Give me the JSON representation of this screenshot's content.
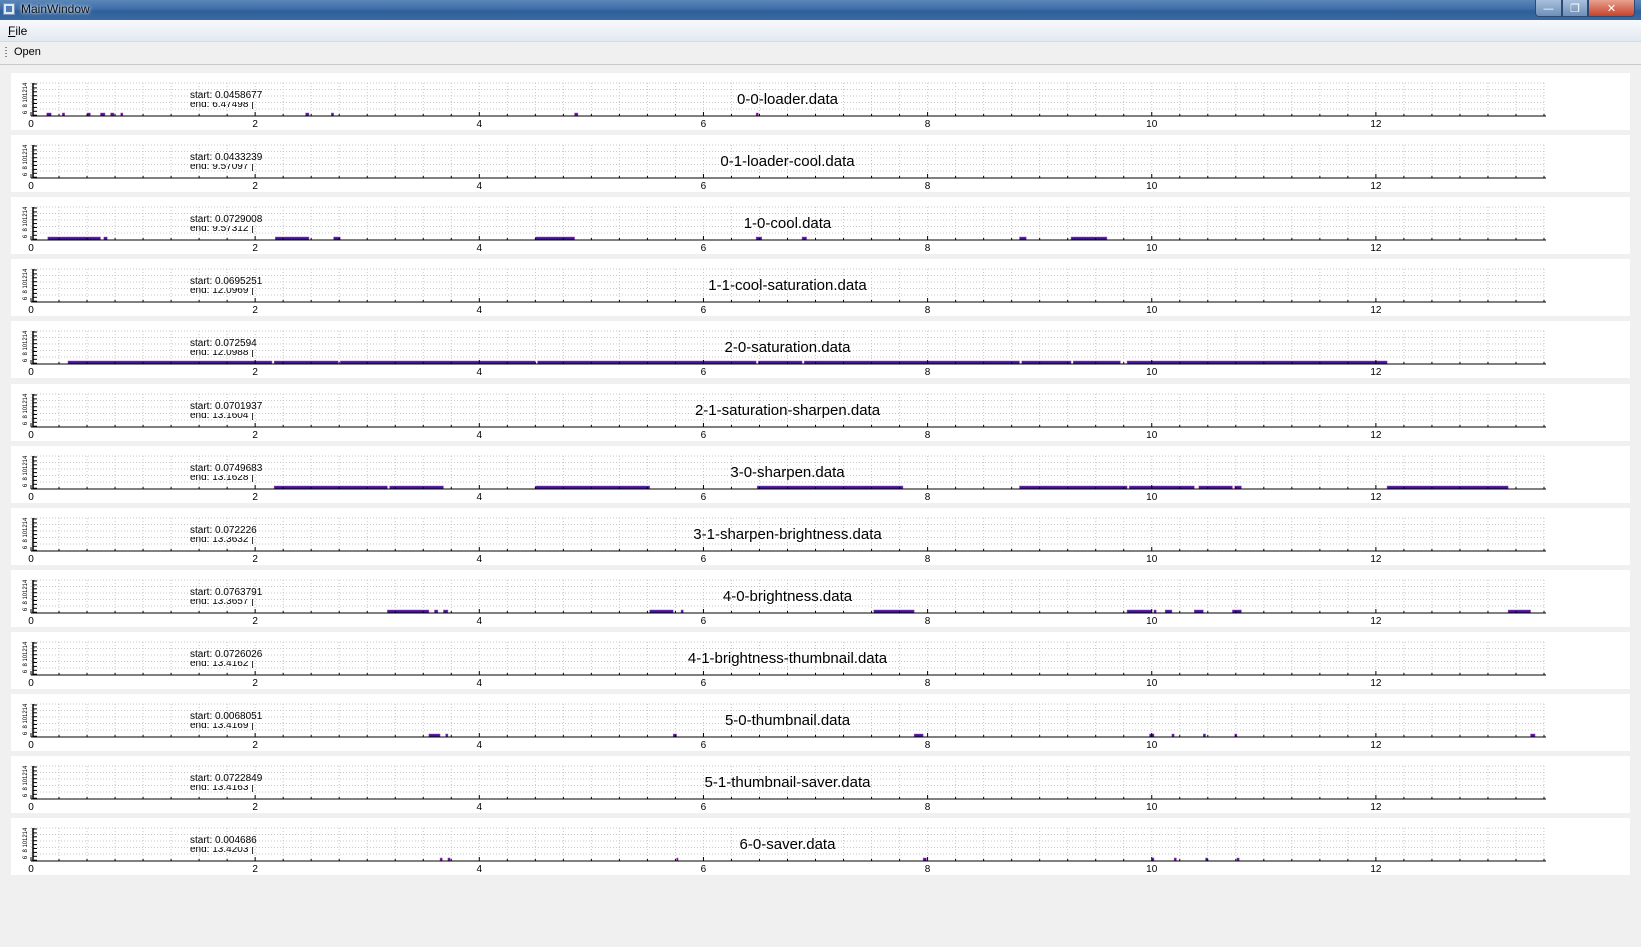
{
  "window": {
    "title": "MainWindow",
    "controls": {
      "minimize": "—",
      "maximize": "❐",
      "close": "✕"
    },
    "icon": "app-window-icon"
  },
  "menubar": {
    "items": [
      {
        "label": "File",
        "mnemonic": "F",
        "rest": "ile"
      }
    ]
  },
  "toolbar": {
    "items": [
      {
        "label": "Open"
      }
    ]
  },
  "plot_style": {
    "axis_color": "#000000",
    "grid_color": "#c8c8c8",
    "bar_color": "#3a1a9a",
    "bar_edge": "#c040c0"
  },
  "chart_data": [
    {
      "type": "bar",
      "title": "0-0-loader.data",
      "start_label": "start: 0.0458677",
      "end_label": "end: 6.47498 |",
      "xlim": [
        0,
        13.5
      ],
      "x_ticks": [
        "0",
        "2",
        "4",
        "6",
        "8",
        "10",
        "12"
      ],
      "y_ticks": [
        "14",
        "12",
        "10",
        "8",
        "6"
      ],
      "intervals": [
        [
          0.14,
          0.18
        ],
        [
          0.28,
          0.3
        ],
        [
          0.5,
          0.53
        ],
        [
          0.62,
          0.66
        ],
        [
          0.71,
          0.74
        ],
        [
          0.8,
          0.82
        ],
        [
          2.45,
          2.48
        ],
        [
          2.68,
          2.7
        ],
        [
          4.85,
          4.88
        ],
        [
          6.47,
          6.49
        ]
      ]
    },
    {
      "type": "bar",
      "title": "0-1-loader-cool.data",
      "start_label": "start: 0.0433239",
      "end_label": "end: 9.57097 |",
      "xlim": [
        0,
        13.5
      ],
      "x_ticks": [
        "0",
        "2",
        "4",
        "6",
        "8",
        "10",
        "12"
      ],
      "y_ticks": [
        "14",
        "12",
        "10",
        "8",
        "6"
      ],
      "intervals": []
    },
    {
      "type": "bar",
      "title": "1-0-cool.data",
      "start_label": "start: 0.0729008",
      "end_label": "end: 9.57312 |",
      "xlim": [
        0,
        13.5
      ],
      "x_ticks": [
        "0",
        "2",
        "4",
        "6",
        "8",
        "10",
        "12"
      ],
      "y_ticks": [
        "14",
        "12",
        "10",
        "8",
        "6"
      ],
      "intervals": [
        [
          0.15,
          0.62
        ],
        [
          0.65,
          0.68
        ],
        [
          2.18,
          2.48
        ],
        [
          2.7,
          2.76
        ],
        [
          4.5,
          4.85
        ],
        [
          6.47,
          6.52
        ],
        [
          6.88,
          6.92
        ],
        [
          8.82,
          8.88
        ],
        [
          9.28,
          9.6
        ]
      ]
    },
    {
      "type": "bar",
      "title": "1-1-cool-saturation.data",
      "start_label": "start: 0.0695251",
      "end_label": "end: 12.0969 |",
      "xlim": [
        0,
        13.5
      ],
      "x_ticks": [
        "0",
        "2",
        "4",
        "6",
        "8",
        "10",
        "12"
      ],
      "y_ticks": [
        "14",
        "12",
        "10",
        "8",
        "6"
      ],
      "intervals": []
    },
    {
      "type": "bar",
      "title": "2-0-saturation.data",
      "start_label": "start: 0.072594",
      "end_label": "end: 12.0988 |",
      "xlim": [
        0,
        13.5
      ],
      "x_ticks": [
        "0",
        "2",
        "4",
        "6",
        "8",
        "10",
        "12"
      ],
      "y_ticks": [
        "14",
        "12",
        "10",
        "8",
        "6"
      ],
      "intervals": [
        [
          0.33,
          2.15
        ],
        [
          2.17,
          2.74
        ],
        [
          2.76,
          4.5
        ],
        [
          4.52,
          6.47
        ],
        [
          6.49,
          6.88
        ],
        [
          6.9,
          8.82
        ],
        [
          8.84,
          9.28
        ],
        [
          9.3,
          9.72
        ],
        [
          9.78,
          12.1
        ]
      ]
    },
    {
      "type": "bar",
      "title": "2-1-saturation-sharpen.data",
      "start_label": "start: 0.0701937",
      "end_label": "end: 13.1604 |",
      "xlim": [
        0,
        13.5
      ],
      "x_ticks": [
        "0",
        "2",
        "4",
        "6",
        "8",
        "10",
        "12"
      ],
      "y_ticks": [
        "14",
        "12",
        "10",
        "8",
        "6"
      ],
      "intervals": []
    },
    {
      "type": "bar",
      "title": "3-0-sharpen.data",
      "start_label": "start: 0.0749683",
      "end_label": "end: 13.1628 |",
      "xlim": [
        0,
        13.5
      ],
      "x_ticks": [
        "0",
        "2",
        "4",
        "6",
        "8",
        "10",
        "12"
      ],
      "y_ticks": [
        "14",
        "12",
        "10",
        "8",
        "6"
      ],
      "intervals": [
        [
          2.17,
          3.18
        ],
        [
          3.2,
          3.68
        ],
        [
          4.5,
          5.52
        ],
        [
          6.48,
          7.78
        ],
        [
          8.82,
          9.78
        ],
        [
          9.8,
          10.38
        ],
        [
          10.42,
          10.72
        ],
        [
          10.74,
          10.8
        ],
        [
          12.1,
          13.18
        ]
      ]
    },
    {
      "type": "bar",
      "title": "3-1-sharpen-brightness.data",
      "start_label": "start: 0.072226",
      "end_label": "end: 13.3632 |",
      "xlim": [
        0,
        13.5
      ],
      "x_ticks": [
        "0",
        "2",
        "4",
        "6",
        "8",
        "10",
        "12"
      ],
      "y_ticks": [
        "14",
        "12",
        "10",
        "8",
        "6"
      ],
      "intervals": []
    },
    {
      "type": "bar",
      "title": "4-0-brightness.data",
      "start_label": "start: 0.0763791",
      "end_label": "end: 13.3657 |",
      "xlim": [
        0,
        13.5
      ],
      "x_ticks": [
        "0",
        "2",
        "4",
        "6",
        "8",
        "10",
        "12"
      ],
      "y_ticks": [
        "14",
        "12",
        "10",
        "8",
        "6"
      ],
      "intervals": [
        [
          3.18,
          3.55
        ],
        [
          3.6,
          3.63
        ],
        [
          3.68,
          3.72
        ],
        [
          5.52,
          5.73
        ],
        [
          5.8,
          5.82
        ],
        [
          7.52,
          7.88
        ],
        [
          9.78,
          10.0
        ],
        [
          10.02,
          10.04
        ],
        [
          10.12,
          10.18
        ],
        [
          10.38,
          10.46
        ],
        [
          10.72,
          10.8
        ],
        [
          13.18,
          13.38
        ]
      ]
    },
    {
      "type": "bar",
      "title": "4-1-brightness-thumbnail.data",
      "start_label": "start: 0.0726026",
      "end_label": "end: 13.4162 |",
      "xlim": [
        0,
        13.5
      ],
      "x_ticks": [
        "0",
        "2",
        "4",
        "6",
        "8",
        "10",
        "12"
      ],
      "y_ticks": [
        "14",
        "12",
        "10",
        "8",
        "6"
      ],
      "intervals": []
    },
    {
      "type": "bar",
      "title": "5-0-thumbnail.data",
      "start_label": "start: 0.0068051",
      "end_label": "end: 13.4169 |",
      "xlim": [
        0,
        13.5
      ],
      "x_ticks": [
        "0",
        "2",
        "4",
        "6",
        "8",
        "10",
        "12"
      ],
      "y_ticks": [
        "14",
        "12",
        "10",
        "8",
        "6"
      ],
      "intervals": [
        [
          3.55,
          3.65
        ],
        [
          3.7,
          3.72
        ],
        [
          5.73,
          5.76
        ],
        [
          7.88,
          7.96
        ],
        [
          9.98,
          10.02
        ],
        [
          10.18,
          10.2
        ],
        [
          10.46,
          10.48
        ],
        [
          10.74,
          10.76
        ],
        [
          13.38,
          13.42
        ]
      ]
    },
    {
      "type": "bar",
      "title": "5-1-thumbnail-saver.data",
      "start_label": "start: 0.0722849",
      "end_label": "end: 13.4163 |",
      "xlim": [
        0,
        13.5
      ],
      "x_ticks": [
        "0",
        "2",
        "4",
        "6",
        "8",
        "10",
        "12"
      ],
      "y_ticks": [
        "14",
        "12",
        "10",
        "8",
        "6"
      ],
      "intervals": []
    },
    {
      "type": "bar",
      "title": "6-0-saver.data",
      "start_label": "start: 0.004686",
      "end_label": "end: 13.4203 |",
      "xlim": [
        0,
        13.5
      ],
      "x_ticks": [
        "0",
        "2",
        "4",
        "6",
        "8",
        "10",
        "12"
      ],
      "y_ticks": [
        "14",
        "12",
        "10",
        "8",
        "6"
      ],
      "intervals": [
        [
          3.65,
          3.67
        ],
        [
          3.72,
          3.74
        ],
        [
          5.76,
          5.77
        ],
        [
          7.96,
          7.99
        ],
        [
          10.0,
          10.02
        ],
        [
          10.2,
          10.22
        ],
        [
          10.48,
          10.5
        ],
        [
          10.76,
          10.78
        ]
      ]
    }
  ]
}
